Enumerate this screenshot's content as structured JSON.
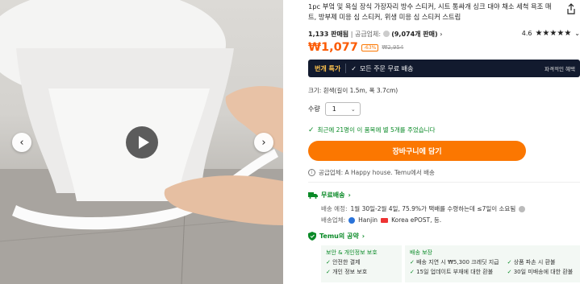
{
  "gallery": {
    "prev_icon": "chevron-left-icon",
    "next_icon": "chevron-right-icon",
    "play_icon": "play-icon"
  },
  "product": {
    "title": "1pc 부엌 및 욕실 장식 가장자리 방수 스티커, 시트 통싸개 싱크 대야 채소 세척 욕조 매트, 방부제 미응 심 스티커, 위생 미응 심 스티커 스트립",
    "sold": "1,133 판매됨",
    "seller_prefix": "공급업체:",
    "seller_sold": "(9,074개 판매)",
    "rating": "4.6",
    "stars": "★★★★★",
    "price": "₩1,077",
    "discount": "-63%",
    "original_price": "₩2,954"
  },
  "banner": {
    "hot": "번개 특가",
    "free_ship": "모든 주문 무료 배송",
    "right": "파격적인 혜택"
  },
  "options": {
    "size": "크기: 흰색(길이 1.5m, 폭 3.7cm)",
    "qty_label": "수량",
    "qty_value": "1"
  },
  "recent": "최근에 21명이 이 품목에 별 5개를 주었습니다",
  "cart_button": "장바구니에 담기",
  "seller_info": "공급업체: A Happy house. Temu에서 배송",
  "shipping": {
    "title": "무료배송",
    "estimate_label": "배송 예정:",
    "estimate_value": "1월 30일-2월 4일, 75.9%가 택배를 수령하는데 ≤7일이 소요됨",
    "carrier_label": "배송업체:",
    "carrier_1": "Hanjin",
    "carrier_2": "Korea ePOST, 등."
  },
  "promise": {
    "title": "Temu의 공약",
    "box1_head": "보안 & 개인정보 보호",
    "box1_items": [
      "안전한 결제",
      "개인 정보 보호"
    ],
    "box2_head": "배송 보장",
    "box2_col1": [
      "배송 지연 시 ₩5,300 크레딧 지급",
      "15일 업데이트 부재에 대한 환불"
    ],
    "box2_col2": [
      "상품 파손 시 환불",
      "30일 미배송에 대한 환불"
    ]
  },
  "colors": {
    "accent": "#fb7701",
    "price": "#fb5b04",
    "green": "#0a8a27",
    "banner_bg": "#121a2e"
  }
}
